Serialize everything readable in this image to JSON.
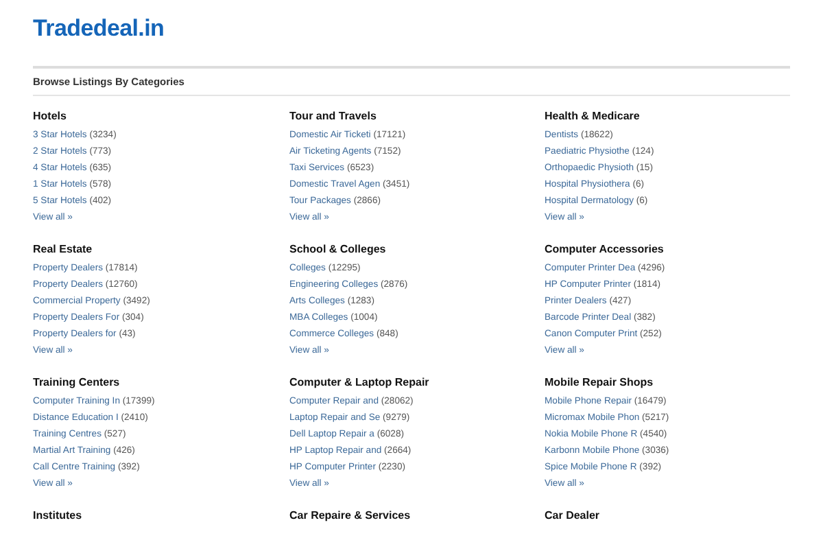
{
  "site_title": "Tradedeal.in",
  "section_title": "Browse Listings By Categories",
  "categories": [
    {
      "name": "Hotels",
      "items": [
        {
          "label": "3 Star Hotels",
          "count": "(3234)"
        },
        {
          "label": "2 Star Hotels",
          "count": "(773)"
        },
        {
          "label": "4 Star Hotels",
          "count": "(635)"
        },
        {
          "label": "1 Star Hotels",
          "count": "(578)"
        },
        {
          "label": "5 Star Hotels",
          "count": "(402)"
        }
      ],
      "view_all": "View all »"
    },
    {
      "name": "Tour and Travels",
      "items": [
        {
          "label": "Domestic Air Ticketi",
          "count": "(17121)"
        },
        {
          "label": "Air Ticketing Agents",
          "count": "(7152)"
        },
        {
          "label": "Taxi Services",
          "count": "(6523)"
        },
        {
          "label": "Domestic Travel Agen",
          "count": "(3451)"
        },
        {
          "label": "Tour Packages",
          "count": "(2866)"
        }
      ],
      "view_all": "View all »"
    },
    {
      "name": "Health & Medicare",
      "items": [
        {
          "label": "Dentists",
          "count": "(18622)"
        },
        {
          "label": "Paediatric Physiothe",
          "count": "(124)"
        },
        {
          "label": "Orthopaedic Physioth",
          "count": "(15)"
        },
        {
          "label": "Hospital Physiothera",
          "count": "(6)"
        },
        {
          "label": "Hospital Dermatology",
          "count": "(6)"
        }
      ],
      "view_all": "View all »"
    },
    {
      "name": "Real Estate",
      "items": [
        {
          "label": "Property Dealers",
          "count": "(17814)"
        },
        {
          "label": "Property Dealers",
          "count": "(12760)"
        },
        {
          "label": "Commercial Property",
          "count": "(3492)"
        },
        {
          "label": "Property Dealers For",
          "count": "(304)"
        },
        {
          "label": "Property Dealers for",
          "count": "(43)"
        }
      ],
      "view_all": "View all »"
    },
    {
      "name": "School & Colleges",
      "items": [
        {
          "label": "Colleges",
          "count": "(12295)"
        },
        {
          "label": "Engineering Colleges",
          "count": "(2876)"
        },
        {
          "label": "Arts Colleges",
          "count": "(1283)"
        },
        {
          "label": "MBA Colleges",
          "count": "(1004)"
        },
        {
          "label": "Commerce Colleges",
          "count": "(848)"
        }
      ],
      "view_all": "View all »"
    },
    {
      "name": "Computer Accessories",
      "items": [
        {
          "label": "Computer Printer Dea",
          "count": "(4296)"
        },
        {
          "label": "HP Computer Printer",
          "count": "(1814)"
        },
        {
          "label": "Printer Dealers",
          "count": "(427)"
        },
        {
          "label": "Barcode Printer Deal",
          "count": "(382)"
        },
        {
          "label": "Canon Computer Print",
          "count": "(252)"
        }
      ],
      "view_all": "View all »"
    },
    {
      "name": "Training Centers",
      "items": [
        {
          "label": "Computer Training In",
          "count": "(17399)"
        },
        {
          "label": "Distance Education I",
          "count": "(2410)"
        },
        {
          "label": "Training Centres",
          "count": "(527)"
        },
        {
          "label": "Martial Art Training",
          "count": "(426)"
        },
        {
          "label": "Call Centre Training",
          "count": "(392)"
        }
      ],
      "view_all": "View all »"
    },
    {
      "name": "Computer & Laptop Repair",
      "items": [
        {
          "label": "Computer Repair and",
          "count": "(28062)"
        },
        {
          "label": "Laptop Repair and Se",
          "count": "(9279)"
        },
        {
          "label": "Dell Laptop Repair a",
          "count": "(6028)"
        },
        {
          "label": "HP Laptop Repair and",
          "count": "(2664)"
        },
        {
          "label": "HP Computer Printer",
          "count": "(2230)"
        }
      ],
      "view_all": "View all »"
    },
    {
      "name": "Mobile Repair Shops",
      "items": [
        {
          "label": "Mobile Phone Repair",
          "count": "(16479)"
        },
        {
          "label": "Micromax Mobile Phon",
          "count": "(5217)"
        },
        {
          "label": "Nokia Mobile Phone R",
          "count": "(4540)"
        },
        {
          "label": "Karbonn Mobile Phone",
          "count": "(3036)"
        },
        {
          "label": "Spice Mobile Phone R",
          "count": "(392)"
        }
      ],
      "view_all": "View all »"
    },
    {
      "name": "Institutes"
    },
    {
      "name": "Car Repaire & Services"
    },
    {
      "name": "Car Dealer"
    }
  ]
}
